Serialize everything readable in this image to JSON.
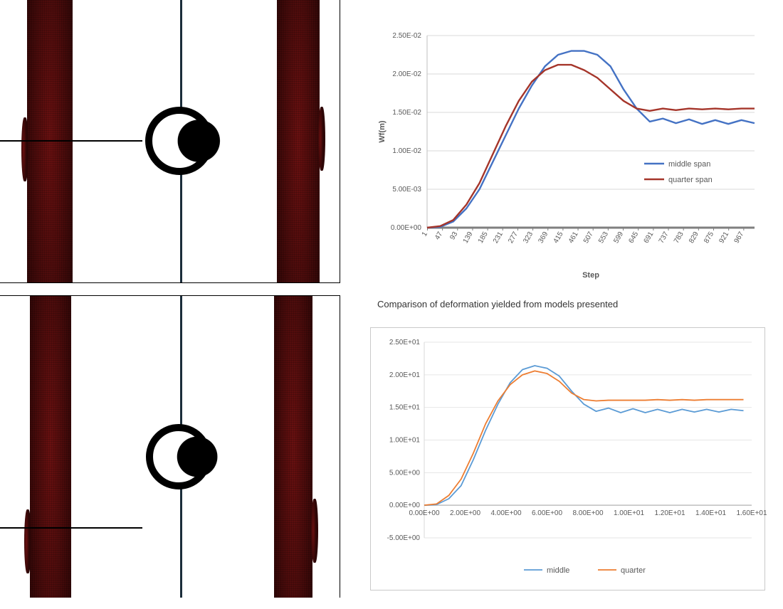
{
  "caption": "Comparison of deformation yielded from models presented",
  "chart_data": [
    {
      "id": "top",
      "type": "line",
      "title": "",
      "xlabel": "Step",
      "ylabel": "Wf(m)",
      "legend_position": "right",
      "x_ticks": [
        1,
        47,
        93,
        139,
        185,
        231,
        277,
        323,
        369,
        415,
        461,
        507,
        553,
        599,
        645,
        691,
        737,
        783,
        829,
        875,
        921,
        967
      ],
      "y_ticks_labels": [
        "0.00E+00",
        "5.00E-03",
        "1.00E-02",
        "1.50E-02",
        "2.00E-02",
        "2.50E-02"
      ],
      "xlim": [
        0,
        1000
      ],
      "ylim": [
        0,
        0.025
      ],
      "series": [
        {
          "name": "middle span",
          "color": "#4472c4",
          "x": [
            0,
            40,
            80,
            120,
            160,
            200,
            240,
            280,
            320,
            360,
            400,
            440,
            480,
            520,
            560,
            600,
            640,
            680,
            720,
            760,
            800,
            840,
            880,
            920,
            960,
            1000
          ],
          "y": [
            0,
            0.0001,
            0.0008,
            0.0025,
            0.005,
            0.0085,
            0.012,
            0.0155,
            0.0185,
            0.021,
            0.0225,
            0.023,
            0.023,
            0.0225,
            0.021,
            0.018,
            0.0155,
            0.0138,
            0.0142,
            0.0136,
            0.0141,
            0.0135,
            0.014,
            0.0135,
            0.014,
            0.0136
          ]
        },
        {
          "name": "quarter span",
          "color": "#a5352a",
          "x": [
            0,
            40,
            80,
            120,
            160,
            200,
            240,
            280,
            320,
            360,
            400,
            440,
            480,
            520,
            560,
            600,
            640,
            680,
            720,
            760,
            800,
            840,
            880,
            920,
            960,
            1000
          ],
          "y": [
            0,
            0.0002,
            0.001,
            0.003,
            0.0058,
            0.0095,
            0.0132,
            0.0165,
            0.019,
            0.0205,
            0.0212,
            0.0212,
            0.0205,
            0.0195,
            0.018,
            0.0165,
            0.0155,
            0.0152,
            0.0155,
            0.0153,
            0.0155,
            0.0154,
            0.0155,
            0.0154,
            0.0155,
            0.0155
          ]
        }
      ]
    },
    {
      "id": "bottom",
      "type": "line",
      "title": "",
      "xlabel": "",
      "ylabel": "",
      "legend_position": "bottom",
      "x_ticks_labels": [
        "0.00E+00",
        "2.00E+00",
        "4.00E+00",
        "6.00E+00",
        "8.00E+00",
        "1.00E+01",
        "1.20E+01",
        "1.40E+01",
        "1.60E+01"
      ],
      "y_ticks_labels": [
        "-5.00E+00",
        "0.00E+00",
        "5.00E+00",
        "1.00E+01",
        "1.50E+01",
        "2.00E+01",
        "2.50E+01"
      ],
      "xlim": [
        0,
        16
      ],
      "ylim": [
        -5,
        25
      ],
      "series": [
        {
          "name": "middle",
          "color": "#5b9bd5",
          "x": [
            0,
            0.6,
            1.2,
            1.8,
            2.4,
            3.0,
            3.6,
            4.2,
            4.8,
            5.4,
            6.0,
            6.6,
            7.2,
            7.8,
            8.4,
            9.0,
            9.6,
            10.2,
            10.8,
            11.4,
            12.0,
            12.6,
            13.2,
            13.8,
            14.4,
            15.0,
            15.6
          ],
          "y": [
            0,
            0.1,
            1.0,
            3.0,
            7.0,
            11.5,
            15.5,
            18.8,
            20.8,
            21.4,
            21.0,
            19.8,
            17.5,
            15.5,
            14.4,
            14.9,
            14.2,
            14.8,
            14.2,
            14.7,
            14.2,
            14.7,
            14.3,
            14.7,
            14.3,
            14.7,
            14.5
          ]
        },
        {
          "name": "quarter",
          "color": "#ed7d31",
          "x": [
            0,
            0.6,
            1.2,
            1.8,
            2.4,
            3.0,
            3.6,
            4.2,
            4.8,
            5.4,
            6.0,
            6.6,
            7.2,
            7.8,
            8.4,
            9.0,
            9.6,
            10.2,
            10.8,
            11.4,
            12.0,
            12.6,
            13.2,
            13.8,
            14.4,
            15.0,
            15.6
          ],
          "y": [
            0,
            0.2,
            1.5,
            4.0,
            8.0,
            12.5,
            16.0,
            18.5,
            20.0,
            20.6,
            20.2,
            19.0,
            17.2,
            16.2,
            16.0,
            16.1,
            16.1,
            16.1,
            16.1,
            16.2,
            16.1,
            16.2,
            16.1,
            16.2,
            16.2,
            16.2,
            16.2
          ]
        }
      ]
    }
  ]
}
